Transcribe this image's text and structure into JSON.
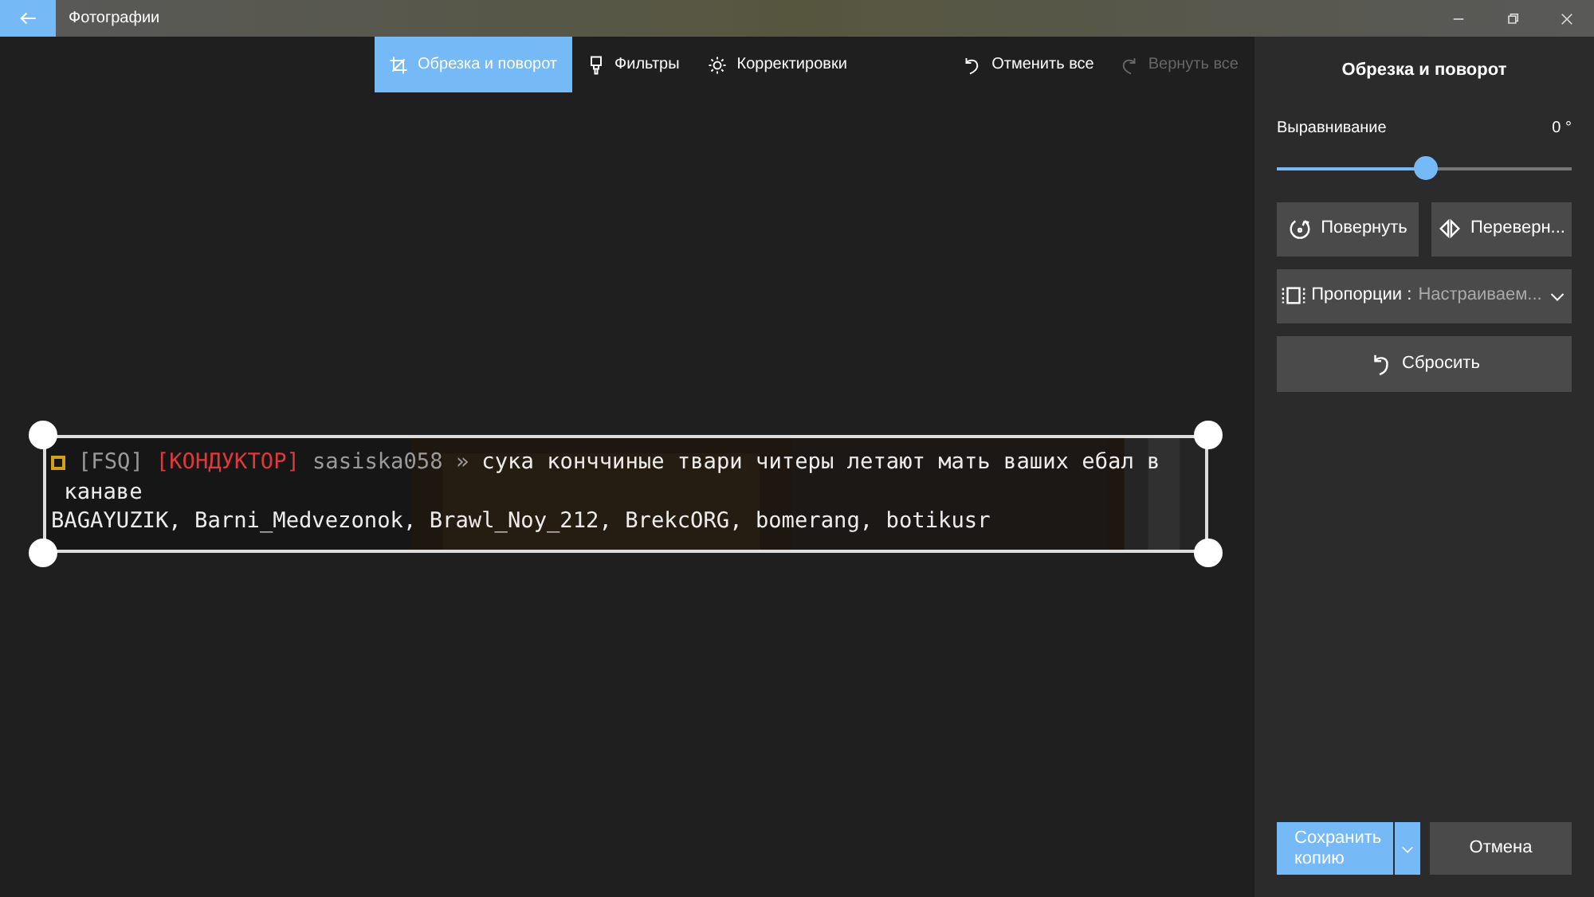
{
  "window": {
    "title": "Фотографии"
  },
  "toolbar": {
    "tabs": [
      {
        "label": "Обрезка и поворот",
        "kind": "crop",
        "selected": true
      },
      {
        "label": "Фильтры",
        "kind": "filter",
        "selected": false
      },
      {
        "label": "Корректировки",
        "kind": "adjust",
        "selected": false
      }
    ],
    "actions": [
      {
        "label": "Отменить все",
        "kind": "undo",
        "disabled": false
      },
      {
        "label": "Вернуть все",
        "kind": "redo",
        "disabled": true
      }
    ]
  },
  "image": {
    "lines": [
      {
        "segments": [
          {
            "kind": "badge",
            "color": "#d4a017"
          },
          {
            "text": "[FSQ]",
            "color": "#9a9a9a"
          },
          {
            "text": "[КОНДУКТОР]",
            "color": "#e0383b"
          },
          {
            "text": "sasiska058 »",
            "color": "#9a9a9a"
          },
          {
            "text": "сука конччиные твари читеры летают мать ваших ебал в",
            "color": "#ececec"
          }
        ]
      },
      {
        "segments": [
          {
            "text": " канаве",
            "color": "#ececec"
          }
        ]
      },
      {
        "segments": [
          {
            "text": "BAGAYUZIK, Barni_Medvezonok, Brawl_Noy_212, BrekcORG, bomerang, botikusr",
            "color": "#ececec"
          }
        ]
      }
    ]
  },
  "panel": {
    "title": "Обрезка и поворот",
    "straighten": {
      "label": "Выравнивание",
      "reading": "0 °",
      "level": 0.5
    },
    "rotate": "Повернуть",
    "flip": "Переверн...",
    "aspect": {
      "label": "Пропорции :",
      "value": "Настраиваем..."
    },
    "reset": "Сбросить",
    "save": "Сохранить копию",
    "cancel": "Отмена"
  }
}
